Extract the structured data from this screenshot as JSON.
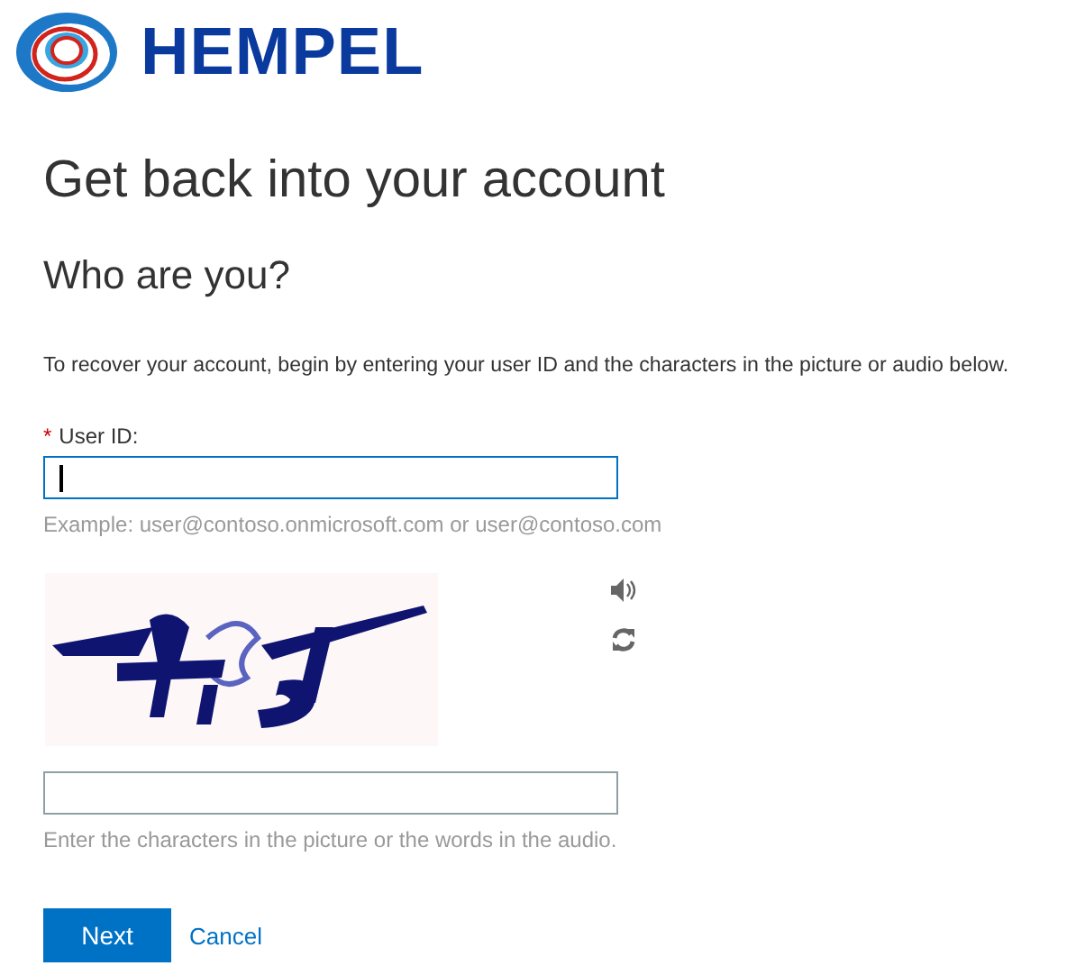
{
  "logo": {
    "text": "HEMPEL"
  },
  "title": "Get back into your account",
  "subtitle": "Who are you?",
  "instructions": "To recover your account, begin by entering your user ID and the characters in the picture or audio below.",
  "user_id_field": {
    "required_mark": "*",
    "label": "User ID:",
    "focused": true,
    "hint": "Example: user@contoso.onmicrosoft.com or user@contoso.com"
  },
  "captcha": {
    "kind": "picture",
    "characters_field": {
      "focused": false,
      "hint": "Enter the characters in the picture or the words in the audio."
    }
  },
  "buttons": [
    {
      "label": "Next",
      "kind": "primary"
    },
    {
      "label": "Cancel",
      "kind": "link"
    }
  ]
}
